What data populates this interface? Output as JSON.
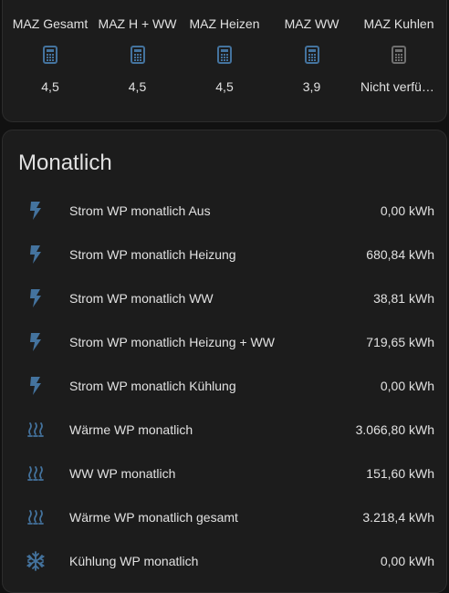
{
  "glance": {
    "items": [
      {
        "name": "MAZ Gesamt",
        "icon": "calculator-icon",
        "state": "4,5",
        "color": "#44739e"
      },
      {
        "name": "MAZ H + WW",
        "icon": "calculator-icon",
        "state": "4,5",
        "color": "#44739e"
      },
      {
        "name": "MAZ Heizen",
        "icon": "calculator-icon",
        "state": "4,5",
        "color": "#44739e"
      },
      {
        "name": "MAZ WW",
        "icon": "calculator-icon",
        "state": "3,9",
        "color": "#44739e"
      },
      {
        "name": "MAZ Kuhlen",
        "icon": "calculator-icon",
        "state": "Nicht verfügbar",
        "color": "#6f6f6f"
      }
    ]
  },
  "monthly": {
    "title": "Monatlich",
    "rows": [
      {
        "icon": "lightning-bolt-icon",
        "name": "Strom WP monatlich Aus",
        "state": "0,00 kWh"
      },
      {
        "icon": "lightning-bolt-icon",
        "name": "Strom WP monatlich Heizung",
        "state": "680,84 kWh"
      },
      {
        "icon": "lightning-bolt-icon",
        "name": "Strom WP monatlich WW",
        "state": "38,81 kWh"
      },
      {
        "icon": "lightning-bolt-icon",
        "name": "Strom WP monatlich Heizung + WW",
        "state": "719,65 kWh"
      },
      {
        "icon": "lightning-bolt-icon",
        "name": "Strom WP monatlich Kühlung",
        "state": "0,00 kWh"
      },
      {
        "icon": "heat-wave-icon",
        "name": "Wärme WP monatlich",
        "state": "3.066,80 kWh"
      },
      {
        "icon": "heat-wave-icon",
        "name": "WW WP monatlich",
        "state": "151,60 kWh"
      },
      {
        "icon": "heat-wave-icon",
        "name": "Wärme WP monatlich gesamt",
        "state": "3.218,4 kWh"
      },
      {
        "icon": "snowflake-icon",
        "name": "Kühlung WP monatlich",
        "state": "0,00 kWh"
      }
    ]
  },
  "colors": {
    "icon_active": "#44739e",
    "icon_unavailable": "#6f6f6f",
    "card_background": "#1c1c1c",
    "page_background": "#111111",
    "text": "#e1e1e1"
  }
}
